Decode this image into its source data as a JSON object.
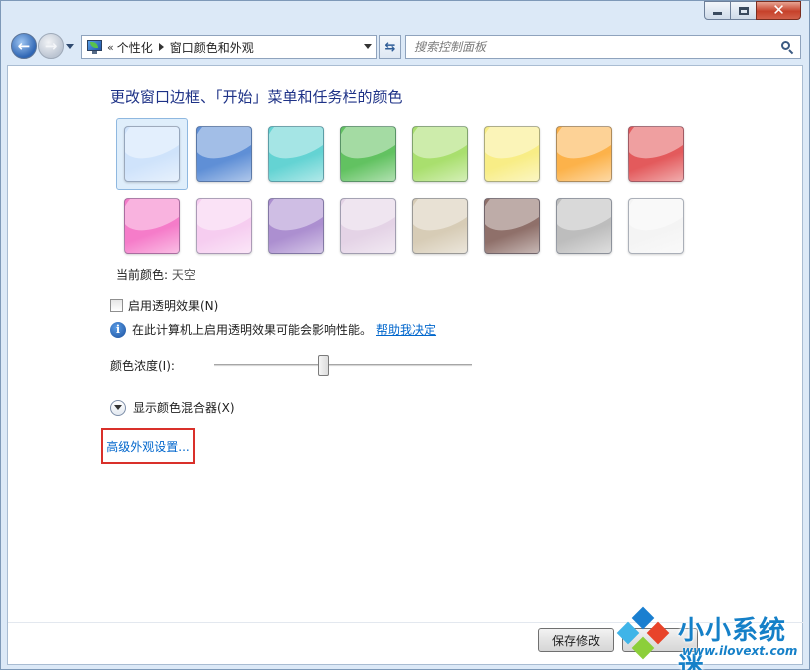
{
  "nav": {
    "breadcrumb": [
      "个性化",
      "窗口颜色和外观"
    ],
    "chevron": "«",
    "search_placeholder": "搜索控制面板"
  },
  "main": {
    "title": "更改窗口边框、「开始」菜单和任务栏的颜色",
    "current_color_label": "当前颜色:",
    "current_color_value": "天空",
    "transparency_label": "启用透明效果(N)",
    "transparency_checked": false,
    "info_text": "在此计算机上启用透明效果可能会影响性能。",
    "help_link": "帮助我决定",
    "intensity_label": "颜色浓度(I):",
    "intensity_value_percent": 42,
    "mixer_label": "显示颜色混合器(X)",
    "advanced_link": "高级外观设置..."
  },
  "colors": {
    "swatches": [
      {
        "hex": "#cfe3fb",
        "selected": true
      },
      {
        "hex": "#5f8fd6",
        "selected": false
      },
      {
        "hex": "#64d3d3",
        "selected": false
      },
      {
        "hex": "#62c261",
        "selected": false
      },
      {
        "hex": "#a9df6e",
        "selected": false
      },
      {
        "hex": "#f8ed86",
        "selected": false
      },
      {
        "hex": "#fcb24a",
        "selected": false
      },
      {
        "hex": "#e35a5c",
        "selected": false
      },
      {
        "hex": "#f57cc9",
        "selected": false
      },
      {
        "hex": "#f6cdf0",
        "selected": false
      },
      {
        "hex": "#ac8fd0",
        "selected": false
      },
      {
        "hex": "#e4d3e6",
        "selected": false
      },
      {
        "hex": "#d7ccb6",
        "selected": false
      },
      {
        "hex": "#8f706a",
        "selected": false
      },
      {
        "hex": "#bdbdbd",
        "selected": false
      },
      {
        "hex": "#f4f4f4",
        "selected": false
      }
    ]
  },
  "footer": {
    "save_label": "保存修改"
  },
  "watermark": {
    "brand": "小小系统迷",
    "url": "www.ilovext.com"
  }
}
